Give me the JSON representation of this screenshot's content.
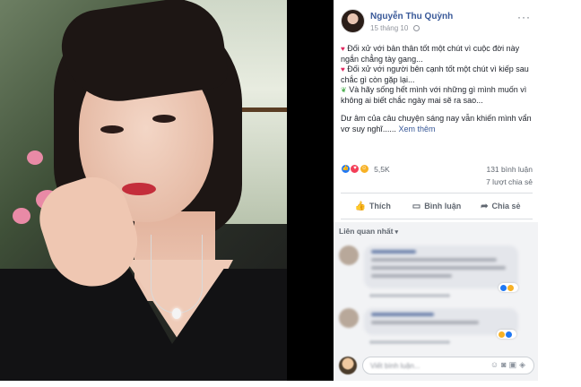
{
  "post": {
    "author": "Nguyễn Thu Quỳnh",
    "time": "15 tháng 10",
    "privacy_icon": "globe-icon",
    "more_label": "···",
    "lines": [
      {
        "icon": "♥",
        "icon_name": "red-heart-icon",
        "text": "Đối xử với bản thân tốt một chút vì cuộc đời này ngắn chẳng tày gang..."
      },
      {
        "icon": "♥",
        "icon_name": "red-heart-icon",
        "text": "Đối xử với người bên cạnh tốt một chút vì kiếp sau chắc gì còn gặp lại..."
      },
      {
        "icon": "❦",
        "icon_name": "seedling-icon",
        "text": "Và hãy sống hết mình với những gì mình muốn vì không ai biết chắc ngày mai sẽ ra sao..."
      }
    ],
    "closing": "Dư âm của câu chuyện sáng nay vẫn khiến mình vẩn vơ suy nghĩ......",
    "see_more": "Xem thêm"
  },
  "reactions": {
    "types": [
      "like",
      "love",
      "haha"
    ],
    "count": "5,5K",
    "comments": "131 bình luận",
    "shares": "7 lượt chia sẻ"
  },
  "actions": {
    "like": "Thích",
    "comment": "Bình luận",
    "share": "Chia sẻ"
  },
  "related": {
    "title": "Liên quan nhất",
    "caret": "▾"
  },
  "composer": {
    "placeholder": "Viết bình luận..."
  },
  "colors": {
    "link": "#385898",
    "heart": "#e0245e",
    "like": "#2078f4",
    "love": "#f33e58",
    "haha": "#f7b125"
  }
}
